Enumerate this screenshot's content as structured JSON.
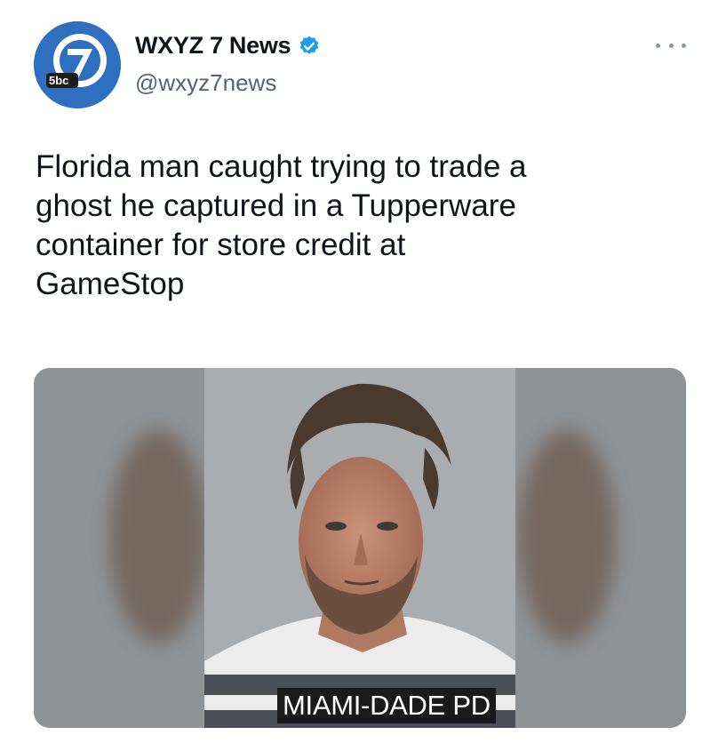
{
  "account": {
    "display_name": "WXYZ 7 News",
    "handle": "@wxyz7news",
    "verified": true,
    "avatar_badge": "5bc",
    "avatar_icon": "channel-7-logo",
    "brand_color": "#2f6fc0"
  },
  "tweet": {
    "text": "Florida man caught trying to trade a\nghost he captured in a Tupperware\ncontainer for store credit at\nGameStop"
  },
  "media": {
    "caption": "MIAMI-DADE PD"
  },
  "icons": {
    "more": "more-horizontal-icon",
    "verified": "verified-badge-icon"
  }
}
